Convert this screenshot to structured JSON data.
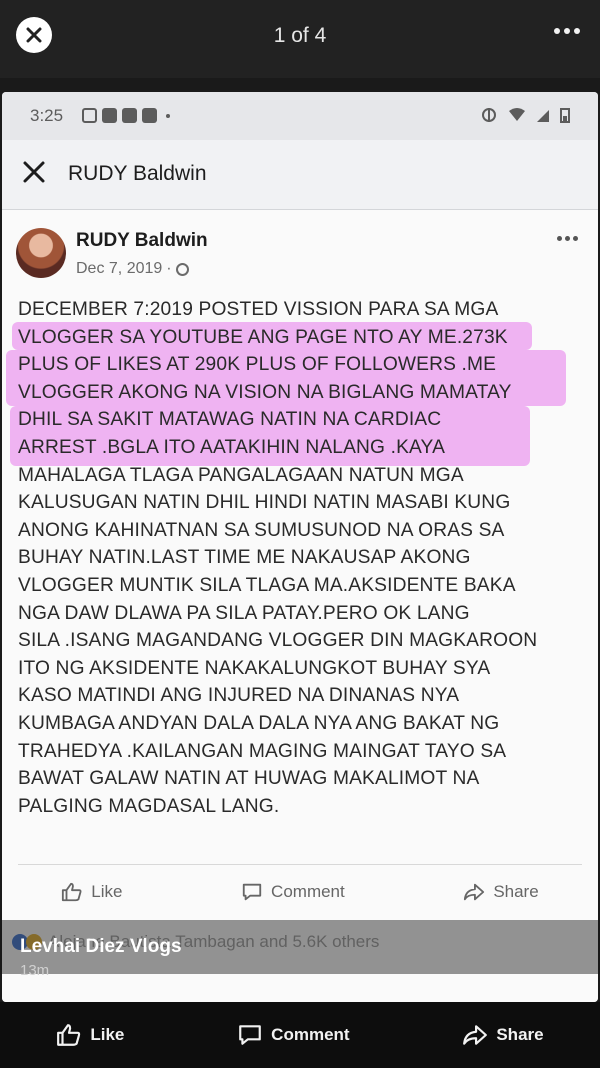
{
  "viewer": {
    "counter": "1 of 4"
  },
  "status": {
    "time": "3:25"
  },
  "header": {
    "title": "RUDY Baldwin"
  },
  "post": {
    "author": "RUDY Baldwin",
    "date": "Dec 7, 2019",
    "lines": [
      "DECEMBER 7:2019 POSTED VISSION PARA SA MGA",
      "VLOGGER SA YOUTUBE ANG PAGE NTO AY ME.273K",
      "PLUS OF LIKES AT 290K PLUS OF FOLLOWERS .ME",
      "VLOGGER AKONG NA VISION NA BIGLANG MAMATAY",
      "DHIL SA SAKIT MATAWAG NATIN NA CARDIAC",
      "ARREST .BGLA ITO AATAKIHIN NALANG .KAYA",
      "MAHALAGA TLAGA PANGALAGAAN NATUN MGA",
      "KALUSUGAN NATIN DHIL HINDI NATIN MASABI KUNG",
      "ANONG KAHINATNAN SA SUMUSUNOD NA ORAS SA",
      "BUHAY NATIN.LAST TIME ME NAKAUSAP AKONG",
      "VLOGGER MUNTIK SILA TLAGA MA.AKSIDENTE BAKA",
      "NGA DAW DLAWA PA SILA PATAY.PERO OK LANG",
      "SILA .ISANG MAGANDANG VLOGGER DIN MAGKAROON",
      "ITO NG AKSIDENTE NAKAKALUNGKOT BUHAY SYA",
      "KASO MATINDI ANG INJURED NA DINANAS NYA",
      "KUMBAGA ANDYAN DALA DALA NYA ANG BAKAT NG",
      "TRAHEDYA .KAILANGAN MAGING MAINGAT TAYO SA",
      "BAWAT GALAW NATIN AT HUWAG MAKALIMOT NA",
      "PALGING MAGDASAL LANG."
    ],
    "actions": {
      "like": "Like",
      "comment": "Comment",
      "share": "Share"
    },
    "reactions_text": "Alejane Bautista Tambagan and 5.6K others"
  },
  "caption": {
    "name": "Levhai Diez Vlogs",
    "time": "13m"
  },
  "bottom_bar": {
    "like": "Like",
    "comment": "Comment",
    "share": "Share"
  },
  "colors": {
    "highlight": "#e678eb",
    "viewer_bg": "#222222",
    "bottom_bg": "#0d0d0d"
  }
}
